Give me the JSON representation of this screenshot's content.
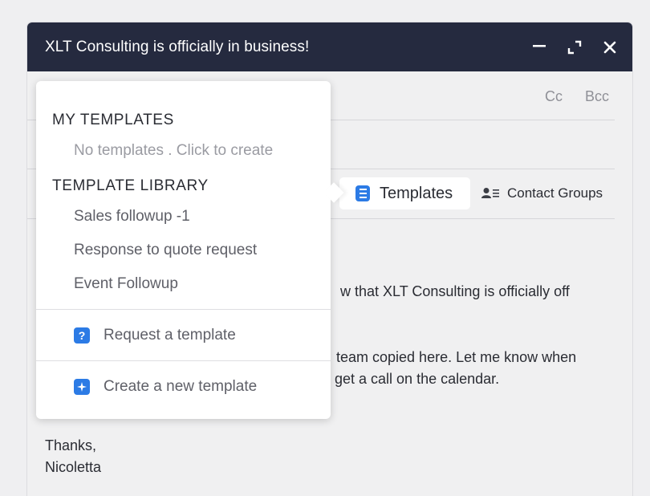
{
  "window": {
    "title": "XLT Consulting is officially in business!",
    "minimize_icon": "minimize-icon",
    "maximize_icon": "expand-icon",
    "close_icon": "close-icon"
  },
  "recipients": {
    "cc_label": "Cc",
    "bcc_label": "Bcc"
  },
  "toolbar": {
    "templates_label": "Templates",
    "templates_icon": "document-icon",
    "contact_groups_label": "Contact Groups",
    "contact_groups_icon": "contact-list-icon"
  },
  "body": {
    "line1": "w that XLT Consulting is officially off",
    "line2": "team copied here. Let me know when",
    "line3": "get a call on the calendar.",
    "signoff": "Thanks,",
    "signature": "Nicoletta"
  },
  "template_menu": {
    "my_templates_header": "MY TEMPLATES",
    "my_templates_empty": "No templates . Click to create",
    "library_header": "TEMPLATE LIBRARY",
    "library_items": [
      {
        "label": "Sales followup -1"
      },
      {
        "label": "Response to quote request"
      },
      {
        "label": "Event Followup"
      }
    ],
    "request_label": "Request a template",
    "request_icon": "question-icon",
    "create_label": "Create a new template",
    "create_icon": "plus-icon"
  },
  "colors": {
    "titlebar": "#252a3f",
    "accent": "#2c7be5",
    "background": "#f0f0f1"
  }
}
